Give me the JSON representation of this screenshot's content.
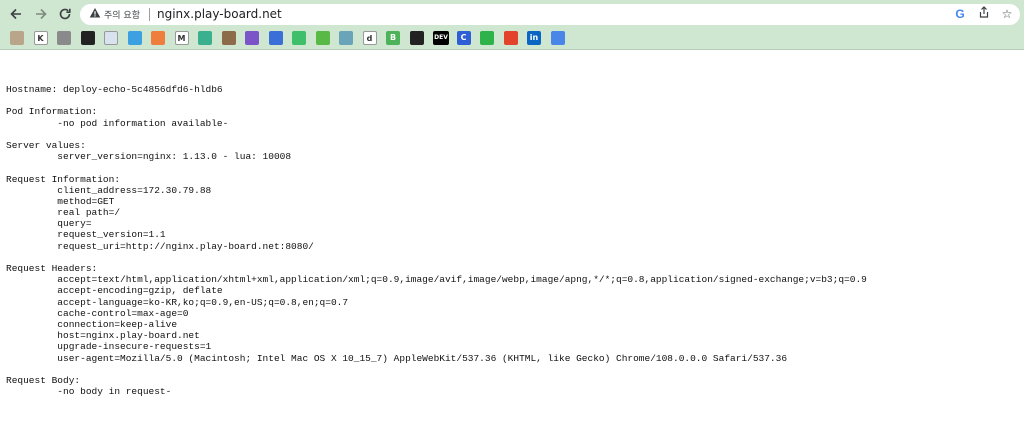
{
  "browser": {
    "security_warning": "주의 요함",
    "url": "nginx.play-board.net",
    "nav_icons": [
      "back-arrow-icon",
      "forward-arrow-icon",
      "reload-icon"
    ],
    "omnibox_icons": [
      "google-icon",
      "share-icon",
      "star-icon"
    ],
    "bookmarks": [
      {
        "name": "notes-bookmark",
        "glyph": "",
        "color": "#b9a58a"
      },
      {
        "name": "k-bookmark",
        "glyph": "K",
        "color": "#ffffff"
      },
      {
        "name": "db-bookmark",
        "glyph": "",
        "color": "#8a8a8a"
      },
      {
        "name": "github-bookmark",
        "glyph": "",
        "color": "#222222"
      },
      {
        "name": "google-news-bookmark",
        "glyph": "",
        "color": "#d9e3ef"
      },
      {
        "name": "pencil-bookmark",
        "glyph": "",
        "color": "#3da0e0"
      },
      {
        "name": "box-bookmark",
        "glyph": "",
        "color": "#ef7d3c"
      },
      {
        "name": "gmail-bookmark",
        "glyph": "M",
        "color": "#ffffff"
      },
      {
        "name": "plant-bookmark",
        "glyph": "",
        "color": "#3bb08f"
      },
      {
        "name": "book-bookmark",
        "glyph": "",
        "color": "#8b6b4a"
      },
      {
        "name": "o-bookmark",
        "glyph": "",
        "color": "#7b55c7"
      },
      {
        "name": "globe-bookmark",
        "glyph": "",
        "color": "#3a6fd8"
      },
      {
        "name": "q-bookmark",
        "glyph": "",
        "color": "#3fbf6a"
      },
      {
        "name": "owl-bookmark",
        "glyph": "",
        "color": "#58b947"
      },
      {
        "name": "gear-bookmark",
        "glyph": "",
        "color": "#6aa4b8"
      },
      {
        "name": "d-bookmark",
        "glyph": "d",
        "color": "#ffffff"
      },
      {
        "name": "b-bookmark",
        "glyph": "B",
        "color": "#4cb35a"
      },
      {
        "name": "dark-globe-bookmark",
        "glyph": "",
        "color": "#222222"
      },
      {
        "name": "dev-bookmark",
        "glyph": "DEV",
        "color": "#000000"
      },
      {
        "name": "c-bookmark",
        "glyph": "C",
        "color": "#2f5fd7"
      },
      {
        "name": "green-app-bookmark",
        "glyph": "",
        "color": "#2db34a"
      },
      {
        "name": "gitlab-bookmark",
        "glyph": "",
        "color": "#e2432a"
      },
      {
        "name": "linkedin-bookmark",
        "glyph": "in",
        "color": "#0a66c2"
      },
      {
        "name": "translate-bookmark",
        "glyph": "",
        "color": "#4a86e8"
      }
    ]
  },
  "content": {
    "lines": [
      "Hostname: deploy-echo-5c4856dfd6-hldb6",
      "",
      "Pod Information:",
      "\t-no pod information available-",
      "",
      "Server values:",
      "\tserver_version=nginx: 1.13.0 - lua: 10008",
      "",
      "Request Information:",
      "\tclient_address=172.30.79.88",
      "\tmethod=GET",
      "\treal path=/",
      "\tquery=",
      "\trequest_version=1.1",
      "\trequest_uri=http://nginx.play-board.net:8080/",
      "",
      "Request Headers:",
      "\taccept=text/html,application/xhtml+xml,application/xml;q=0.9,image/avif,image/webp,image/apng,*/*;q=0.8,application/signed-exchange;v=b3;q=0.9",
      "\taccept-encoding=gzip, deflate",
      "\taccept-language=ko-KR,ko;q=0.9,en-US;q=0.8,en;q=0.7",
      "\tcache-control=max-age=0",
      "\tconnection=keep-alive",
      "\thost=nginx.play-board.net",
      "\tupgrade-insecure-requests=1",
      "\tuser-agent=Mozilla/5.0 (Macintosh; Intel Mac OS X 10_15_7) AppleWebKit/537.36 (KHTML, like Gecko) Chrome/108.0.0.0 Safari/537.36",
      "",
      "Request Body:",
      "\t-no body in request-"
    ]
  }
}
